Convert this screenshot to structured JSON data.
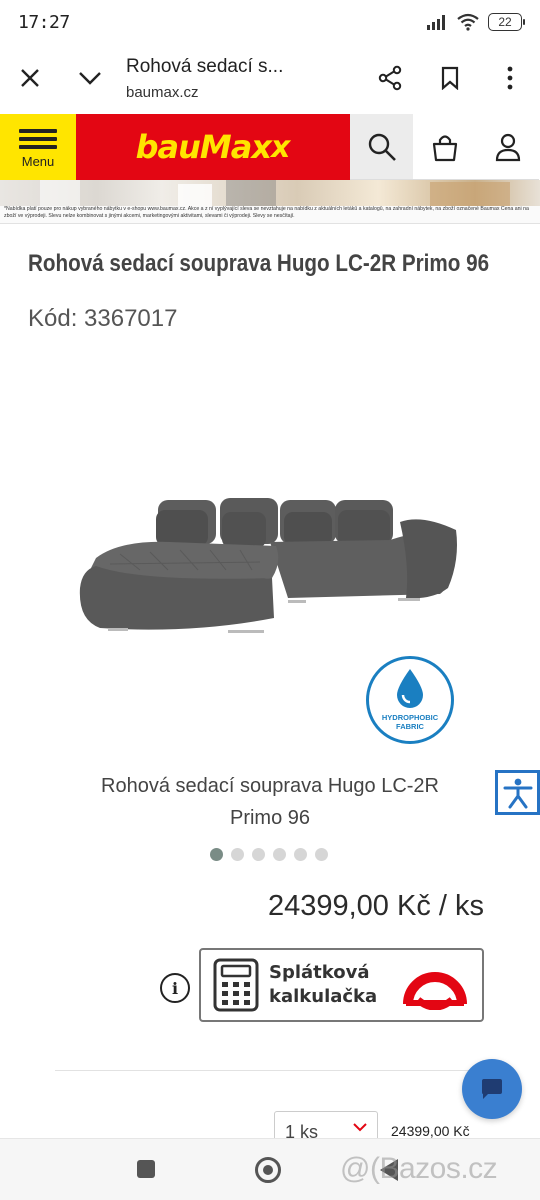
{
  "status_bar": {
    "time": "17:27",
    "battery": "22"
  },
  "browser": {
    "page_title": "Rohová sedací s...",
    "domain": "baumax.cz"
  },
  "site_header": {
    "menu_label": "Menu",
    "logo_text": "bauMax",
    "logo_suffix": "x",
    "brand_red": "#e30613",
    "brand_yellow": "#ffe500"
  },
  "banner": {
    "disclaimer": "*Nabídka platí pouze pro nákup vybraného nábytku v e-shopu www.baumax.cz. Akce a z ní vyplývající sleva se nevztahuje na nabídku z aktuálních letáků a katalogů, na zahradní nábytek, na zboží označené Baumax Cena ani na zboží ve výprodeji. Slevu nelze kombinovat s jinými akcemi, marketingovými aktivitami, slevami či výprodeji. Slevy se nesčítají."
  },
  "product": {
    "title": "Rohová sedací souprava Hugo LC-2R Primo 96",
    "code": "Kód: 3367017",
    "badge_line1": "HYDROPHOBIC",
    "badge_line2": "FABRIC",
    "caption_line1": "Rohová sedací souprava Hugo LC-2R",
    "caption_line2": "Primo 96",
    "gallery_count": 6,
    "gallery_active": 1,
    "price": "24399,00 Kč / ks",
    "calculator_line1": "Splátková",
    "calculator_line2": "kalkulačka",
    "quantity": "1 ks",
    "total": "24399,00 Kč"
  },
  "watermark": "@(Bazos.cz"
}
